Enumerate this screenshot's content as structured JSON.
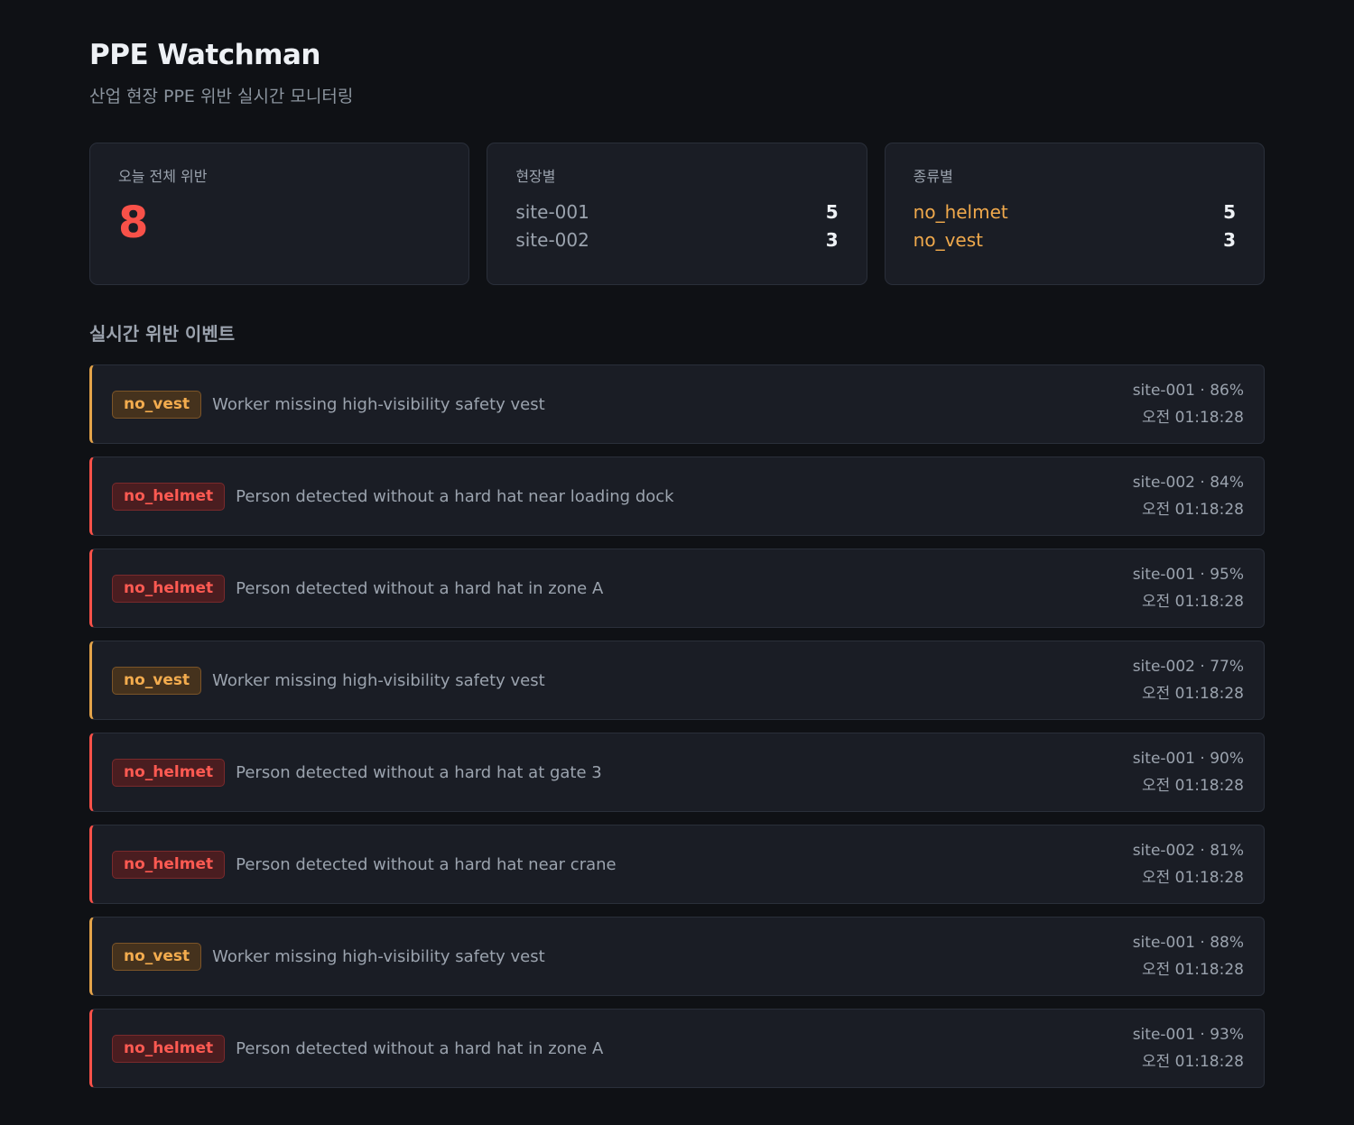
{
  "header": {
    "title": "PPE Watchman",
    "subtitle": "산업 현장 PPE 위반 실시간 모니터링"
  },
  "stats": {
    "total": {
      "label": "오늘 전체 위반",
      "value": "8"
    },
    "by_site": {
      "label": "현장별",
      "rows": [
        {
          "name": "site-001",
          "count": "5"
        },
        {
          "name": "site-002",
          "count": "3"
        }
      ]
    },
    "by_type": {
      "label": "종류별",
      "rows": [
        {
          "name": "no_helmet",
          "count": "5"
        },
        {
          "name": "no_vest",
          "count": "3"
        }
      ]
    }
  },
  "events_section": {
    "title": "실시간 위반 이벤트",
    "events": [
      {
        "type": "no_vest",
        "description": "Worker missing high-visibility safety vest",
        "meta": "site-001 · 86%",
        "time": "오전 01:18:28"
      },
      {
        "type": "no_helmet",
        "description": "Person detected without a hard hat near loading dock",
        "meta": "site-002 · 84%",
        "time": "오전 01:18:28"
      },
      {
        "type": "no_helmet",
        "description": "Person detected without a hard hat in zone A",
        "meta": "site-001 · 95%",
        "time": "오전 01:18:28"
      },
      {
        "type": "no_vest",
        "description": "Worker missing high-visibility safety vest",
        "meta": "site-002 · 77%",
        "time": "오전 01:18:28"
      },
      {
        "type": "no_helmet",
        "description": "Person detected without a hard hat at gate 3",
        "meta": "site-001 · 90%",
        "time": "오전 01:18:28"
      },
      {
        "type": "no_helmet",
        "description": "Person detected without a hard hat near crane",
        "meta": "site-002 · 81%",
        "time": "오전 01:18:28"
      },
      {
        "type": "no_vest",
        "description": "Worker missing high-visibility safety vest",
        "meta": "site-001 · 88%",
        "time": "오전 01:18:28"
      },
      {
        "type": "no_helmet",
        "description": "Person detected without a hard hat in zone A",
        "meta": "site-001 · 93%",
        "time": "오전 01:18:28"
      }
    ]
  },
  "colors": {
    "background": "#0f1115",
    "card": "#1a1d25",
    "helmet_accent": "#f85149",
    "vest_accent": "#e3a34a"
  }
}
